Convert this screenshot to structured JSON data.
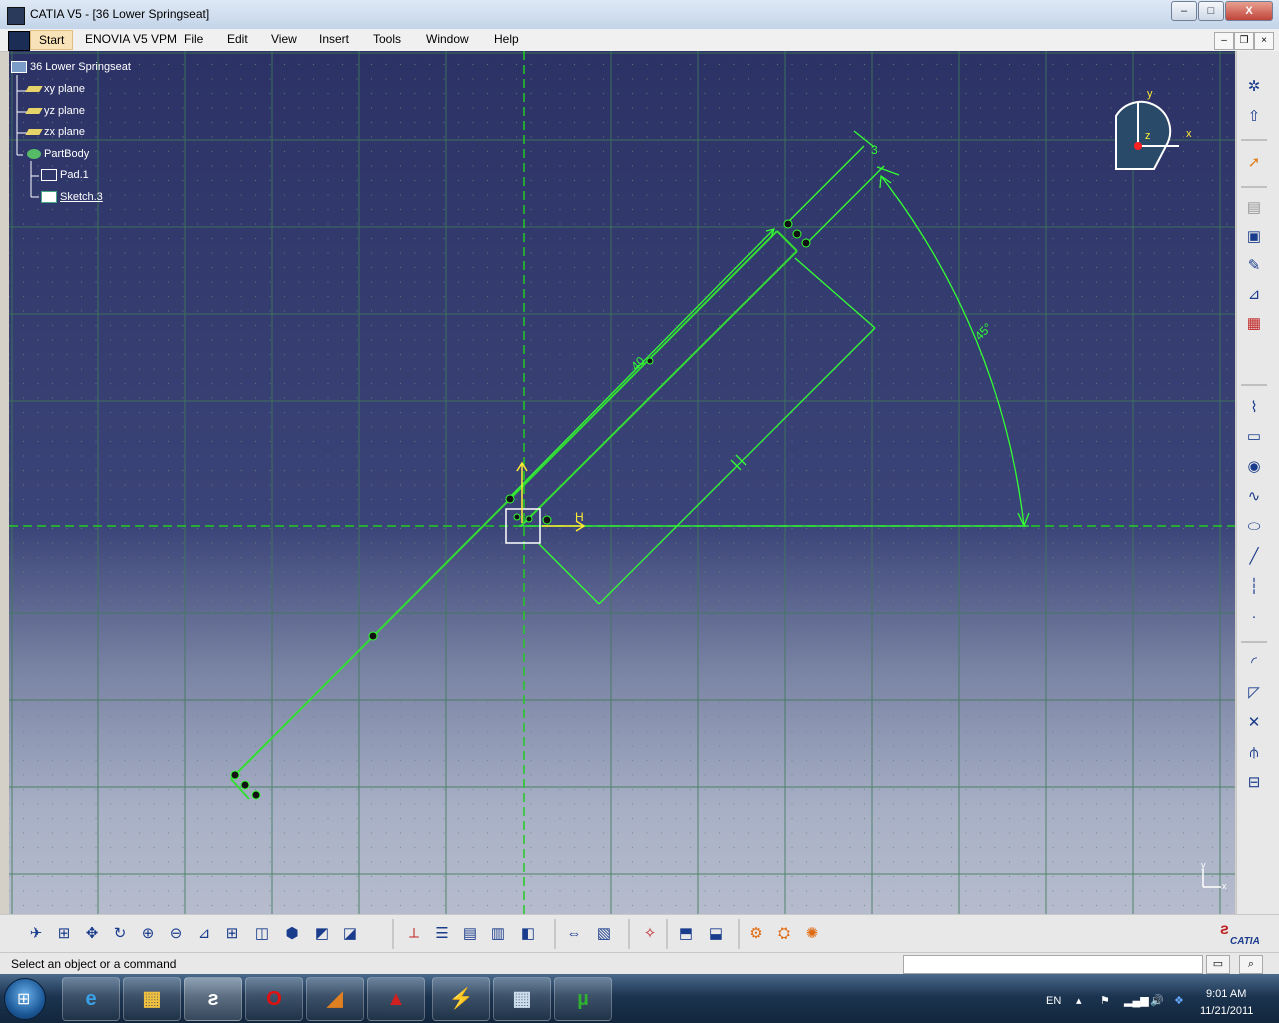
{
  "window": {
    "title": "CATIA V5 - [36 Lower Springseat]",
    "min": "–",
    "max": "□",
    "close": "X"
  },
  "menu": {
    "start": "Start",
    "enovia": "ENOVIA V5 VPM",
    "file": "File",
    "edit": "Edit",
    "view": "View",
    "insert": "Insert",
    "tools": "Tools",
    "window": "Window",
    "help": "Help"
  },
  "mdi": {
    "min": "–",
    "restore": "❐",
    "close": "×"
  },
  "tree": {
    "root": "36 Lower Springseat",
    "xy": "xy plane",
    "yz": "yz plane",
    "zx": "zx plane",
    "body": "PartBody",
    "pad": "Pad.1",
    "sketch": "Sketch.3"
  },
  "sketch": {
    "dim_length": "40",
    "dim_thickness": "3",
    "dim_angle": "45°",
    "h_label": "H"
  },
  "compass": {
    "x": "x",
    "y": "y",
    "z": "z"
  },
  "axes_indicator": {
    "y": "y",
    "x": "x"
  },
  "status": {
    "message": "Select an object or a command",
    "command_value": ""
  },
  "brand": {
    "logo_text": "CATIA"
  },
  "tray": {
    "lang": "EN",
    "time": "9:01 AM",
    "date": "11/21/2011"
  },
  "colors": {
    "sketch_green": "#33dd33",
    "axis_green": "#22cc22",
    "dim_green": "#33ff33",
    "h_yellow": "#ffee33"
  }
}
